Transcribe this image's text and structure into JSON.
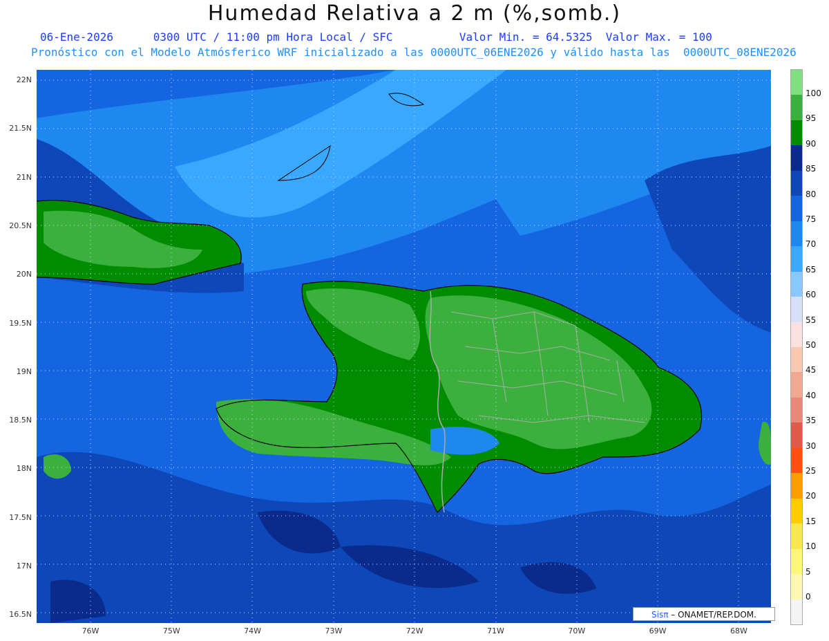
{
  "header": {
    "title": "Humedad Relativa a 2 m (%,somb.)",
    "line2": "06-Ene-2026      0300 UTC / 11:00 pm Hora Local / SFC          Valor Min. = 64.5325  Valor Max. = 100",
    "line3": "Pronóstico con el Modelo Atmósferico WRF inicializado a las 0000UTC_06ENE2026 y válido hasta las  0000UTC_08ENE2026"
  },
  "axes": {
    "lat_labels": [
      "22N",
      "21.5N",
      "21N",
      "20.5N",
      "20N",
      "19.5N",
      "19N",
      "18.5N",
      "18N",
      "17.5N",
      "17N",
      "16.5N"
    ],
    "lon_labels": [
      "76W",
      "75W",
      "74W",
      "73W",
      "72W",
      "71W",
      "70W",
      "69W",
      "68W"
    ]
  },
  "colorbar": {
    "labels": [
      "100",
      "95",
      "90",
      "85",
      "80",
      "75",
      "70",
      "65",
      "60",
      "55",
      "50",
      "45",
      "40",
      "35",
      "30",
      "25",
      "20",
      "15",
      "10",
      "5",
      "0"
    ],
    "colors": [
      "#7ee07e",
      "#3cb03c",
      "#008c00",
      "#0a2a8c",
      "#0d47b8",
      "#1565e0",
      "#1e88f0",
      "#3aa8ff",
      "#88c8ff",
      "#d6e0f8",
      "#fde0e0",
      "#f8c8b0",
      "#f0a890",
      "#e88878",
      "#e05a4a",
      "#ff5010",
      "#ff9c00",
      "#ffcc00",
      "#f8e850",
      "#fff578",
      "#fff8b0",
      "#f4f4f4"
    ]
  },
  "credit": {
    "sis": "Sisπ",
    "rest": "– ONAMET/REP.DOM."
  }
}
